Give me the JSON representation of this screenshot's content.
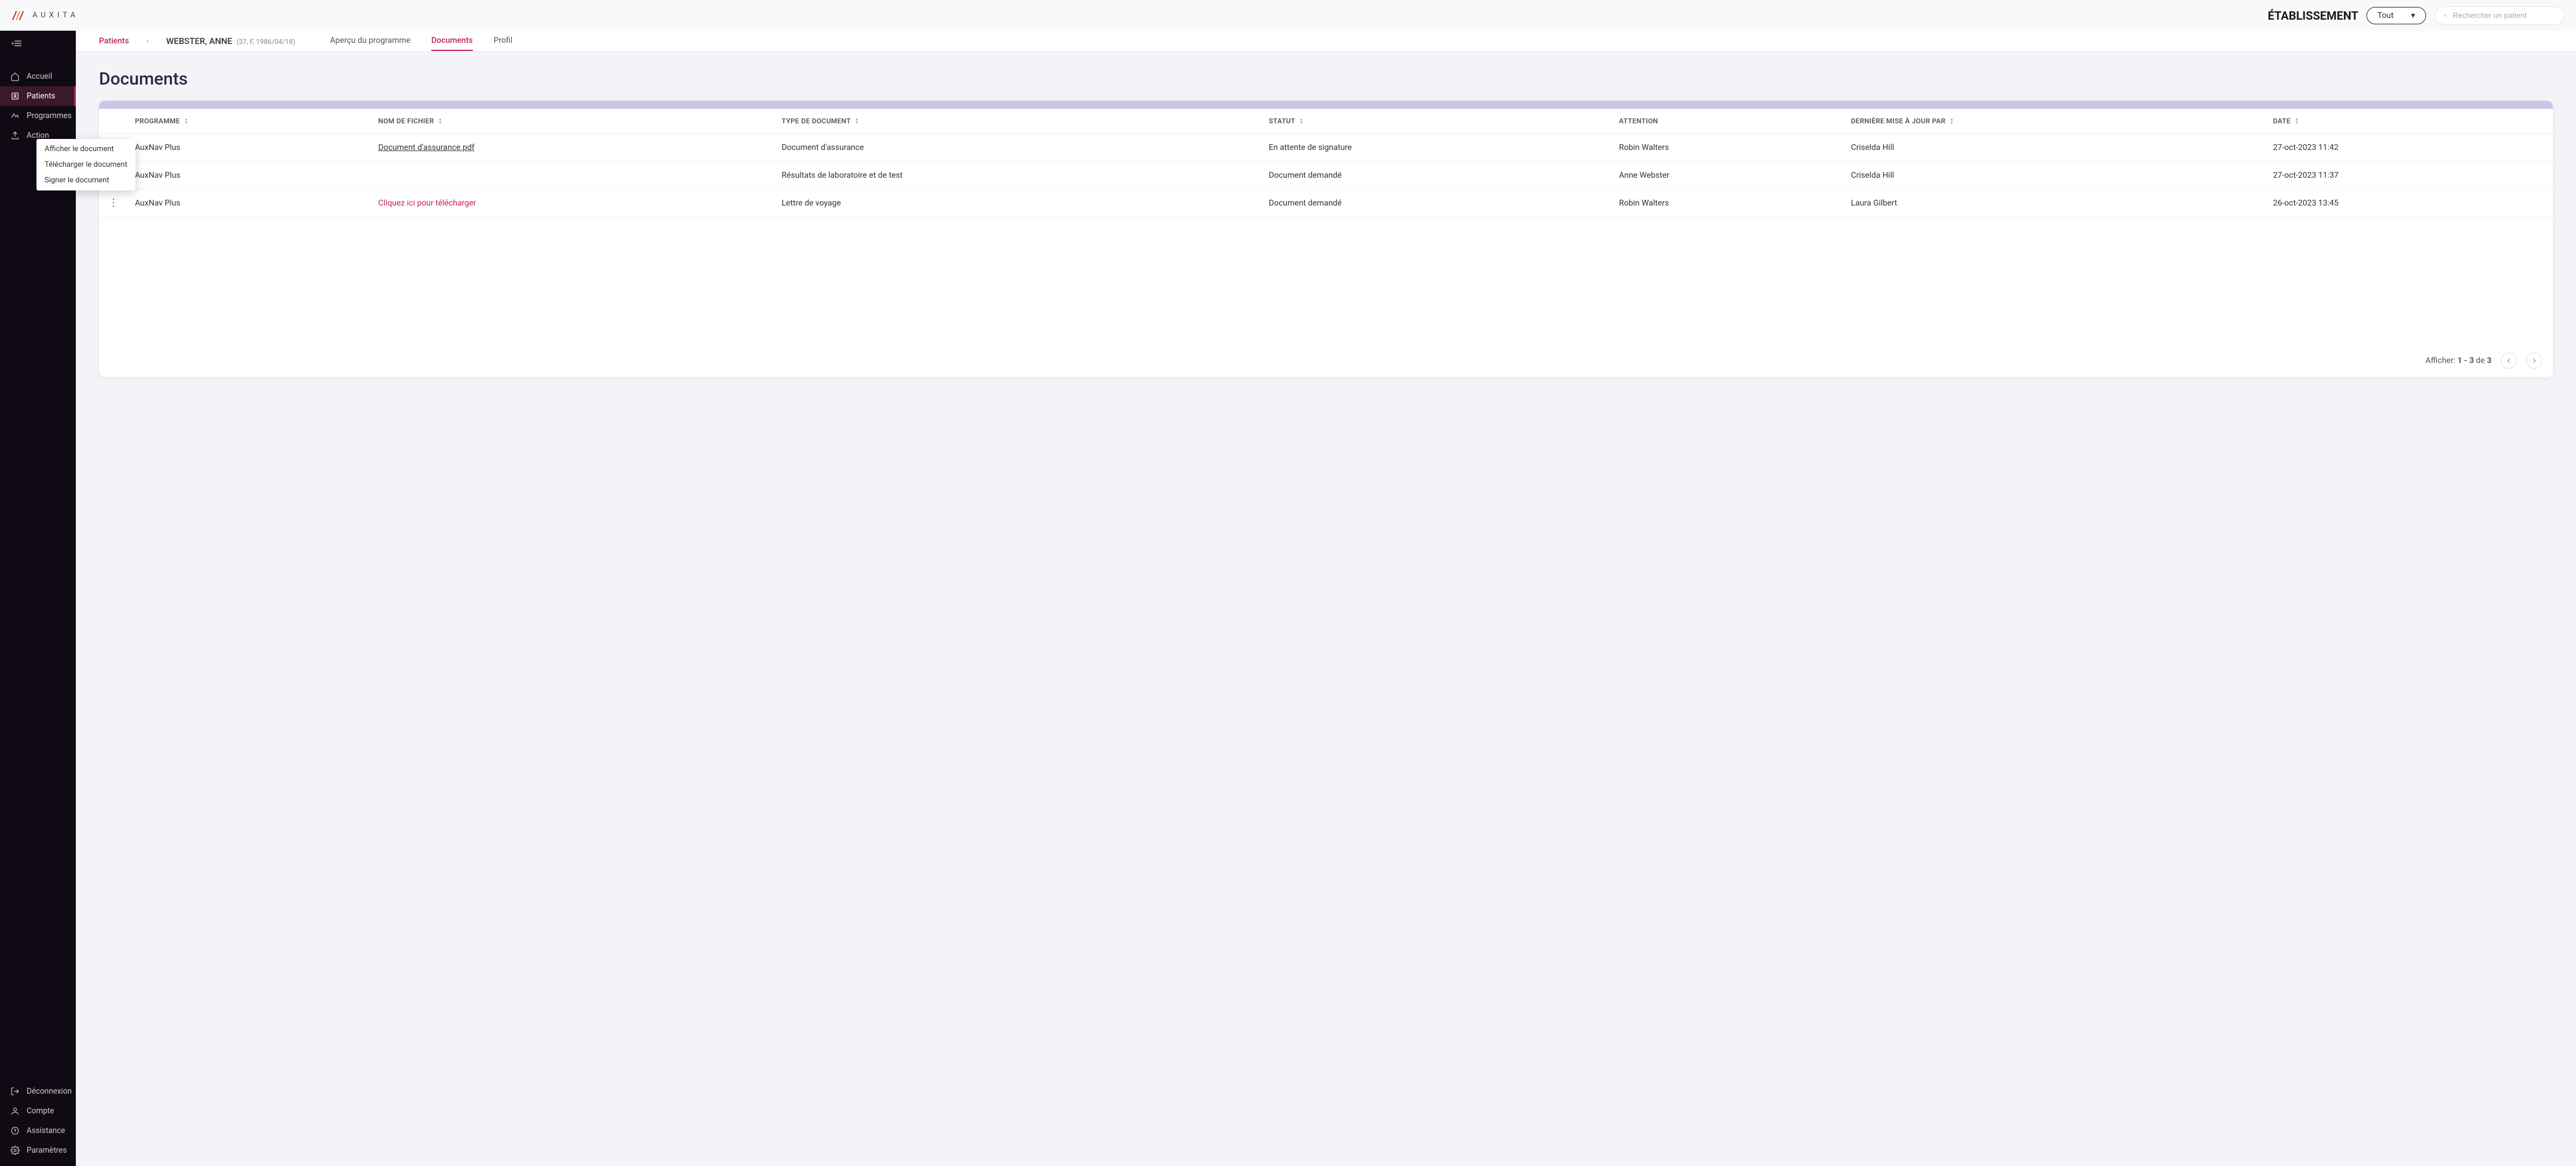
{
  "header": {
    "brand": "AUXITA",
    "etablissement_label": "ÉTABLISSEMENT",
    "filter_value": "Tout",
    "search_placeholder": "Rechercher un patient"
  },
  "breadcrumb": {
    "root": "Patients",
    "patient_name": "WEBSTER, ANNE",
    "patient_meta": "(37, F, 1986/04/18)"
  },
  "subtabs": {
    "overview": "Aperçu du programme",
    "documents": "Documents",
    "profile": "Profil"
  },
  "sidebar": {
    "accueil": "Accueil",
    "patients": "Patients",
    "programmes": "Programmes",
    "actions": "Action",
    "deconnexion": "Déconnexion",
    "compte": "Compte",
    "assistance": "Assistance",
    "parametres": "Paramètres"
  },
  "page": {
    "title": "Documents"
  },
  "columns": {
    "programme": "PROGRAMME",
    "filename": "NOM DE FICHIER",
    "doctype": "TYPE DE DOCUMENT",
    "status": "STATUT",
    "attention": "ATTENTION",
    "updated_by": "DERNIÈRE MISE À JOUR PAR",
    "date": "DATE"
  },
  "rows": [
    {
      "programme": "AuxNav Plus",
      "filename": "Document d'assurance.pdf",
      "filename_style": "link",
      "doctype": "Document d'assurance",
      "status": "En attente de signature",
      "attention": "Robin Walters",
      "updated_by": "Criselda Hill",
      "date": "27-oct-2023 11:42"
    },
    {
      "programme": "AuxNav Plus",
      "filename": "",
      "filename_style": "none",
      "doctype": "Résultats de laboratoire et de test",
      "status": "Document demandé",
      "attention": "Anne Webster",
      "updated_by": "Criselda Hill",
      "date": "27-oct-2023 11:37"
    },
    {
      "programme": "AuxNav Plus",
      "filename": "Cliquez ici pour télécharger",
      "filename_style": "upload",
      "doctype": "Lettre de voyage",
      "status": "Document demandé",
      "attention": "Robin Walters",
      "updated_by": "Laura Gilbert",
      "date": "26-oct-2023 13:45"
    }
  ],
  "context_menu": {
    "view": "Afficher le document",
    "download": "Télécharger le document",
    "sign": "Signer le document"
  },
  "pagination": {
    "label_prefix": "Afficher: ",
    "range": "1 - 3",
    "of": " de ",
    "total": "3"
  }
}
